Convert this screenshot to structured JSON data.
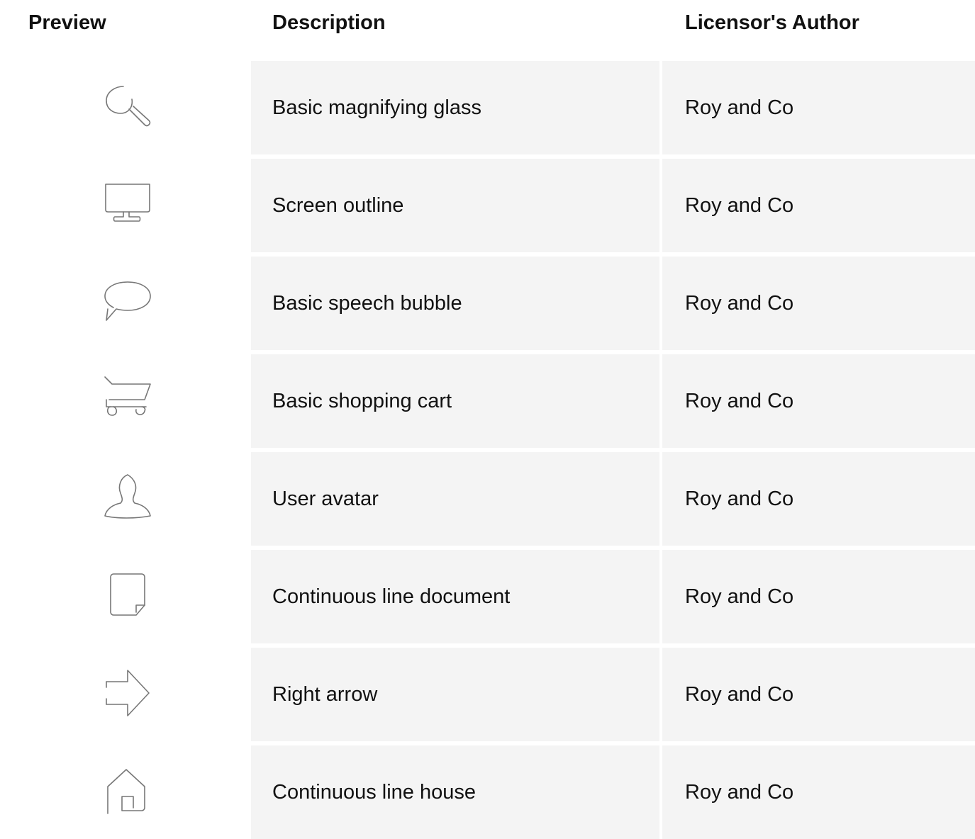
{
  "table": {
    "headers": {
      "preview": "Preview",
      "description": "Description",
      "author": "Licensor's Author"
    },
    "rows": [
      {
        "icon": "magnifying-glass-icon",
        "description": "Basic magnifying glass",
        "author": "Roy and Co"
      },
      {
        "icon": "monitor-icon",
        "description": "Screen outline",
        "author": "Roy and Co"
      },
      {
        "icon": "speech-bubble-icon",
        "description": "Basic speech bubble",
        "author": "Roy and Co"
      },
      {
        "icon": "shopping-cart-icon",
        "description": "Basic shopping cart",
        "author": "Roy and Co"
      },
      {
        "icon": "user-avatar-icon",
        "description": "User avatar",
        "author": "Roy and Co"
      },
      {
        "icon": "document-icon",
        "description": "Continuous line document",
        "author": "Roy and Co"
      },
      {
        "icon": "right-arrow-icon",
        "description": "Right arrow",
        "author": "Roy and Co"
      },
      {
        "icon": "house-icon",
        "description": "Continuous line house",
        "author": "Roy and Co"
      }
    ]
  },
  "colors": {
    "row_background": "#f4f4f4",
    "icon_stroke": "#777777",
    "text": "#111111"
  }
}
